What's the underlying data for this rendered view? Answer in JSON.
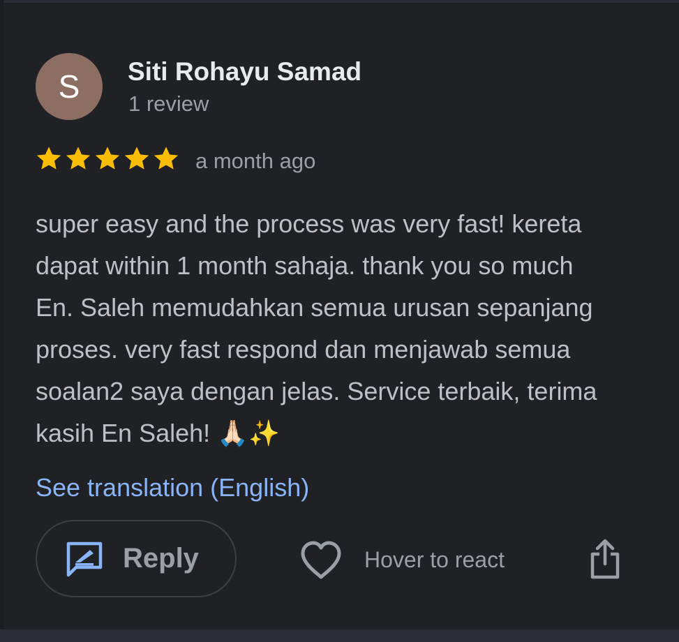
{
  "reviewer": {
    "avatar_letter": "S",
    "avatar_color": "#8d6e63",
    "name": "Siti Rohayu Samad",
    "review_count": "1 review"
  },
  "rating": {
    "stars": 5,
    "max_stars": 5,
    "star_color": "#fbbc04",
    "time_ago": "a month ago"
  },
  "review": {
    "lines": [
      "super easy and the process was very fast! kereta",
      "dapat within 1 month sahaja. thank you so much",
      "En. Saleh memudahkan semua urusan sepanjang",
      "proses. very fast respond dan menjawab semua",
      "soalan2 saya dengan jelas. Service terbaik, terima",
      "kasih En Saleh! 🙏🏻✨"
    ]
  },
  "translation_link": "See translation (English)",
  "actions": {
    "reply_label": "Reply",
    "react_label": "Hover to react",
    "reply_icon": "reply-icon",
    "heart_icon": "heart-icon",
    "share_icon": "share-icon"
  },
  "colors": {
    "background": "#202124",
    "link": "#8ab4f8",
    "reply_icon": "#8ab4f8"
  }
}
